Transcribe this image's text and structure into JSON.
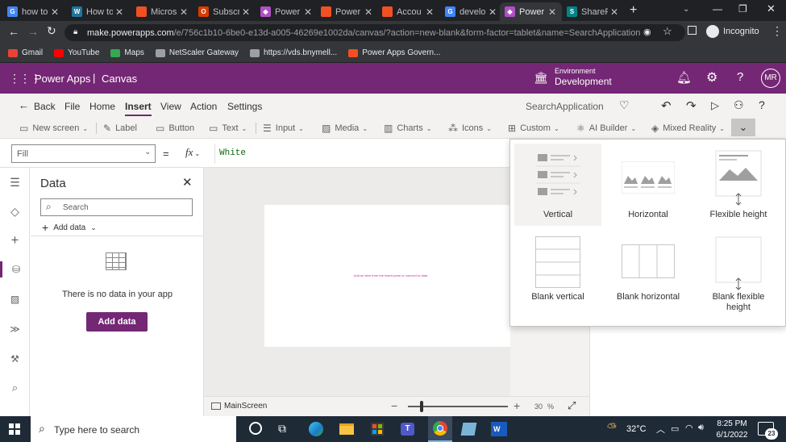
{
  "browser": {
    "tabs": [
      {
        "title": "how to",
        "icon": "google-icon",
        "color": "#4285f4",
        "glyph": "G"
      },
      {
        "title": "How to",
        "icon": "wordpress-icon",
        "color": "#21759b",
        "glyph": "W"
      },
      {
        "title": "Micros",
        "icon": "microsoft-icon",
        "color": "#f25022",
        "glyph": ""
      },
      {
        "title": "Subscr",
        "icon": "office-icon",
        "color": "#d83b01",
        "glyph": "O"
      },
      {
        "title": "Power",
        "icon": "powerapps-icon",
        "color": "#b14fc5",
        "glyph": "◆"
      },
      {
        "title": "Power",
        "icon": "microsoft-icon",
        "color": "#f25022",
        "glyph": ""
      },
      {
        "title": "Accou",
        "icon": "microsoft-icon",
        "color": "#f25022",
        "glyph": ""
      },
      {
        "title": "develo",
        "icon": "google-icon",
        "color": "#4285f4",
        "glyph": "G"
      },
      {
        "title": "Power",
        "icon": "powerapps-icon",
        "color": "#b14fc5",
        "glyph": "◆"
      },
      {
        "title": "ShareP",
        "icon": "sharepoint-icon",
        "color": "#038387",
        "glyph": "S"
      }
    ],
    "active_tab": 8,
    "url_host": "make.powerapps.com",
    "url_path": "/e/756c1b10-6be0-e13d-a005-46269e1002da/canvas/?action=new-blank&form-factor=tablet&name=SearchApplication",
    "profile_label": "Incognito",
    "bookmarks": [
      {
        "label": "Gmail",
        "icon": "gmail-icon",
        "color": "#ea4335"
      },
      {
        "label": "YouTube",
        "icon": "youtube-icon",
        "color": "#ff0000"
      },
      {
        "label": "Maps",
        "icon": "maps-icon",
        "color": "#34a853"
      },
      {
        "label": "NetScaler Gateway",
        "icon": "netscaler-icon",
        "color": "#9aa0a6"
      },
      {
        "label": "https://vds.bnymell...",
        "icon": "lock-icon",
        "color": "#9aa0a6"
      },
      {
        "label": "Power Apps Govern...",
        "icon": "microsoft-icon",
        "color": "#f25022"
      }
    ]
  },
  "app": {
    "brand": "Power Apps",
    "separator": "|",
    "mode": "Canvas",
    "env_label": "Environment",
    "env_name": "Development",
    "avatar": "MR"
  },
  "menu": {
    "back": "Back",
    "items": [
      "File",
      "Home",
      "Insert",
      "View",
      "Action",
      "Settings"
    ],
    "active": "Insert",
    "app_name": "SearchApplication"
  },
  "insert_toolbar": [
    {
      "label": "New screen",
      "icon": "screen-icon",
      "glyph": "▭"
    },
    {
      "label": "Label",
      "icon": "label-icon",
      "glyph": "✎"
    },
    {
      "label": "Button",
      "icon": "button-icon",
      "glyph": "▭"
    },
    {
      "label": "Text",
      "icon": "text-icon",
      "glyph": "▭"
    },
    {
      "label": "Input",
      "icon": "input-icon",
      "glyph": "☰"
    },
    {
      "label": "Media",
      "icon": "media-icon",
      "glyph": "▨"
    },
    {
      "label": "Charts",
      "icon": "chart-icon",
      "glyph": "▥"
    },
    {
      "label": "Icons",
      "icon": "icons-icon",
      "glyph": "⁂"
    },
    {
      "label": "Custom",
      "icon": "custom-icon",
      "glyph": "⊞"
    },
    {
      "label": "AI Builder",
      "icon": "ai-builder-icon",
      "glyph": "⚛"
    },
    {
      "label": "Mixed Reality",
      "icon": "mixed-reality-icon",
      "glyph": "◈"
    }
  ],
  "formula": {
    "property": "Fill",
    "equals": "=",
    "fx": "fx",
    "value": "White"
  },
  "data_panel": {
    "title": "Data",
    "search_placeholder": "Search",
    "add_data_link": "Add data",
    "empty_message": "There is no data in your app",
    "add_data_button": "Add data"
  },
  "canvas": {
    "hint": "Add an item from the Insert pane or connect to data",
    "screen_name": "MainScreen",
    "zoom": "30",
    "zoom_unit": "%",
    "zoom_minus": "−",
    "zoom_plus": "+"
  },
  "gallery_menu": {
    "options": [
      "Vertical",
      "Horizontal",
      "Flexible height",
      "Blank vertical",
      "Blank horizontal",
      "Blank flexible height"
    ],
    "selected": "Vertical"
  },
  "taskbar": {
    "search_placeholder": "Type here to search",
    "temperature": "32°C",
    "time": "8:25 PM",
    "date": "6/1/2022",
    "notifications": "23"
  },
  "colors": {
    "brand": "#742774",
    "chrome_dark": "#202124",
    "chrome_mid": "#35363a",
    "taskbar": "#1f2a37"
  }
}
